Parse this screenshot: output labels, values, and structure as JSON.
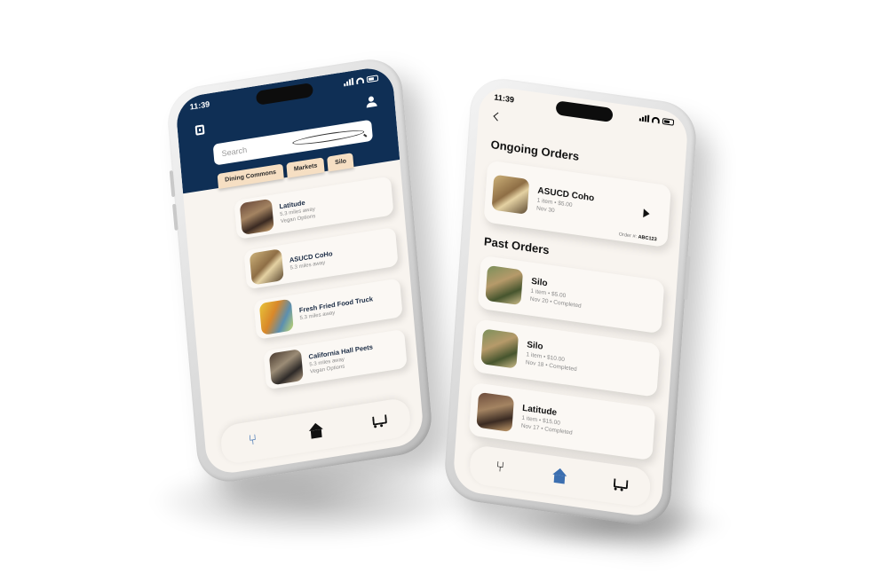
{
  "left_phone": {
    "status": {
      "time": "11:39"
    },
    "search": {
      "placeholder": "Search"
    },
    "tabs": [
      "Dining Commons",
      "Markets",
      "Silo"
    ],
    "locations": [
      {
        "name": "Latitude",
        "distance": "5.3 miles away",
        "note": "Vegan Options"
      },
      {
        "name": "ASUCD CoHo",
        "distance": "5.3 miles away",
        "note": ""
      },
      {
        "name": "Fresh Fried Food Truck",
        "distance": "5.3 miles away",
        "note": ""
      },
      {
        "name": "California Hall Peets",
        "distance": "5.3 miles away",
        "note": "Vegan Options"
      }
    ]
  },
  "right_phone": {
    "status": {
      "time": "11:39"
    },
    "ongoing_title": "Ongoing Orders",
    "ongoing": {
      "name": "ASUCD Coho",
      "summary": "1 item • $5.00",
      "date": "Nov 30",
      "order_label": "Order #:",
      "order_number": "ABC123"
    },
    "past_title": "Past Orders",
    "past": [
      {
        "name": "Silo",
        "summary": "1 item • $5.00",
        "status": "Nov 20 • Completed"
      },
      {
        "name": "Silo",
        "summary": "1 item • $10.00",
        "status": "Nov 18 • Completed"
      },
      {
        "name": "Latitude",
        "summary": "1 item • $15.00",
        "status": "Nov 17 • Completed"
      }
    ]
  },
  "colors": {
    "navy": "#0f2f55",
    "tab": "#f6dfc3",
    "accent": "#3c6fb0",
    "background": "#f8f4ef"
  }
}
